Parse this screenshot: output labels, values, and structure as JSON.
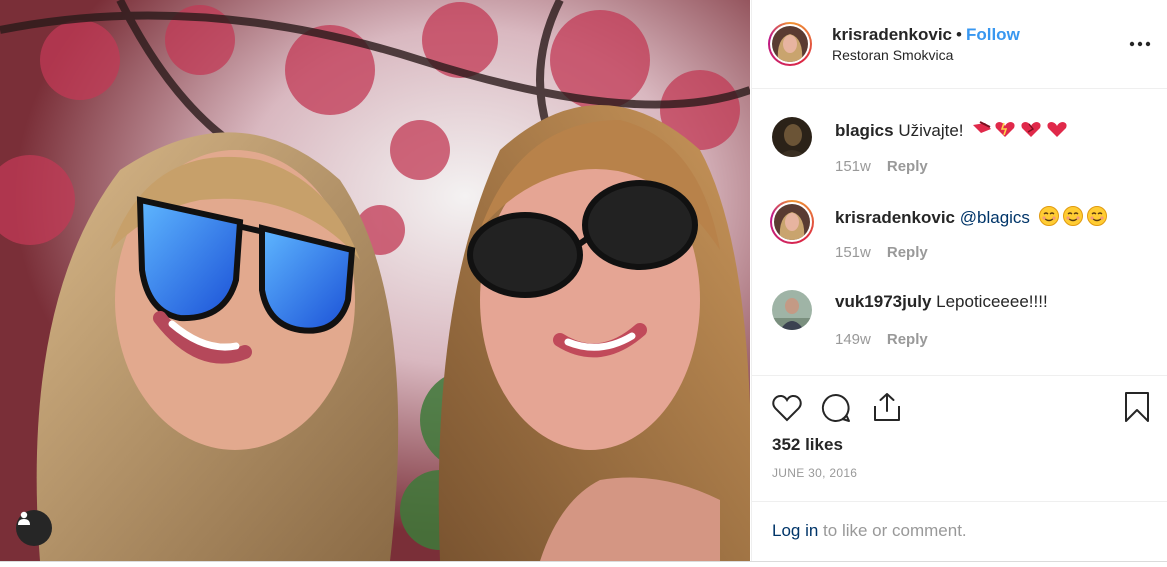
{
  "header": {
    "username": "krisradenkovic",
    "separator": "•",
    "follow_label": "Follow",
    "location": "Restoran Smokvica",
    "more_icon": "more-horizontal-icon"
  },
  "comments": [
    {
      "username": "blagics",
      "mention": "",
      "text": "Uživajte!",
      "emoji": "hearts-emoji",
      "time": "151w",
      "reply_label": "Reply"
    },
    {
      "username": "krisradenkovic",
      "mention": "@blagics",
      "text": "",
      "emoji": "smiling-face-emoji",
      "time": "151w",
      "reply_label": "Reply"
    },
    {
      "username": "vuk1973july",
      "mention": "",
      "text": "Lepoticeeee!!!!",
      "emoji": "",
      "time": "149w",
      "reply_label": "Reply"
    }
  ],
  "actions": {
    "like_icon": "heart-icon",
    "comment_icon": "comment-icon",
    "share_icon": "share-icon",
    "save_icon": "bookmark-icon"
  },
  "likes_text": "352 likes",
  "date": "JUNE 30, 2016",
  "login": {
    "link_label": "Log in",
    "rest_text": " to like or comment."
  },
  "colors": {
    "follow_blue": "#3897f0",
    "link_dark_blue": "#003569",
    "muted_gray": "#999999",
    "border": "#efefef"
  }
}
